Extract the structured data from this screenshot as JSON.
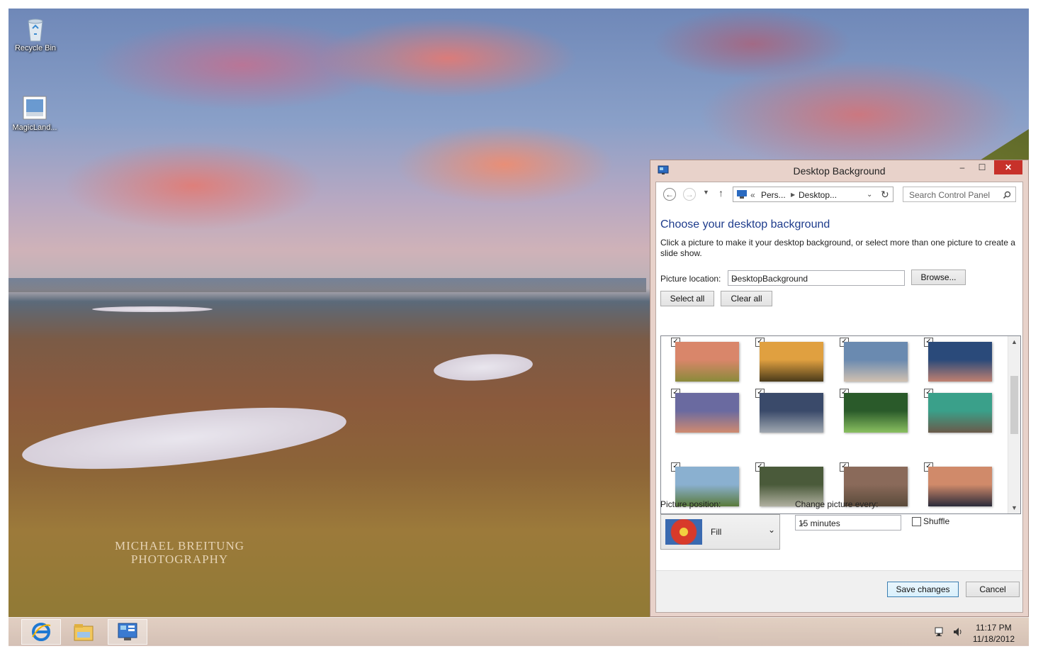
{
  "desktop": {
    "watermark_line1": "MICHAEL BREITUNG",
    "watermark_line2": "PHOTOGRAPHY",
    "icons": [
      {
        "label": "Recycle Bin",
        "icon": "recycle-bin-icon"
      },
      {
        "label": "MagicLand...",
        "icon": "theme-file-icon"
      }
    ]
  },
  "taskbar": {
    "apps": [
      {
        "name": "Internet Explorer",
        "icon": "internet-explorer-icon"
      },
      {
        "name": "File Explorer",
        "icon": "file-explorer-icon"
      },
      {
        "name": "Control Panel",
        "icon": "control-panel-icon"
      }
    ],
    "time": "11:17 PM",
    "date": "11/18/2012"
  },
  "window": {
    "title": "Desktop Background",
    "controls": {
      "minimize": "–",
      "maximize": "☐",
      "close": "✕"
    },
    "address": {
      "prefix": "«",
      "crumb1": "Pers...",
      "crumb2": "Desktop..."
    },
    "search_placeholder": "Search Control Panel",
    "heading": "Choose your desktop background",
    "description": "Click a picture to make it your desktop background, or select more than one picture to create a slide show.",
    "picture_location_label": "Picture location:",
    "picture_location_value": "DesktopBackground",
    "browse_label": "Browse...",
    "select_all_label": "Select all",
    "clear_all_label": "Clear all",
    "thumbnails": [
      {
        "checked": true,
        "colors": [
          "#d9866a",
          "#8a8a3a"
        ]
      },
      {
        "checked": true,
        "colors": [
          "#e0a040",
          "#4a3a1a"
        ]
      },
      {
        "checked": true,
        "colors": [
          "#6a8ab0",
          "#d0c0b0"
        ]
      },
      {
        "checked": true,
        "colors": [
          "#2a4a7a",
          "#c08070"
        ]
      },
      {
        "checked": true,
        "colors": [
          "#6a6aa0",
          "#d08a70"
        ]
      },
      {
        "checked": true,
        "colors": [
          "#3a4a6a",
          "#a0a8b0"
        ]
      },
      {
        "checked": true,
        "colors": [
          "#2a5a2a",
          "#8ac060"
        ]
      },
      {
        "checked": true,
        "colors": [
          "#3aa08a",
          "#6a5a4a"
        ]
      },
      {
        "checked": true,
        "colors": [
          "#8ab0d0",
          "#5a7a3a"
        ]
      },
      {
        "checked": true,
        "colors": [
          "#4a5a3a",
          "#b0b0a0"
        ]
      },
      {
        "checked": true,
        "colors": [
          "#8a6a5a",
          "#5a4a3a"
        ]
      },
      {
        "checked": true,
        "colors": [
          "#d08a6a",
          "#2a2a3a"
        ]
      }
    ],
    "picture_position_label": "Picture position:",
    "picture_position_value": "Fill",
    "change_every_label": "Change picture every:",
    "change_every_value": "15 minutes",
    "shuffle_label": "Shuffle",
    "shuffle_checked": false,
    "save_label": "Save changes",
    "cancel_label": "Cancel"
  }
}
